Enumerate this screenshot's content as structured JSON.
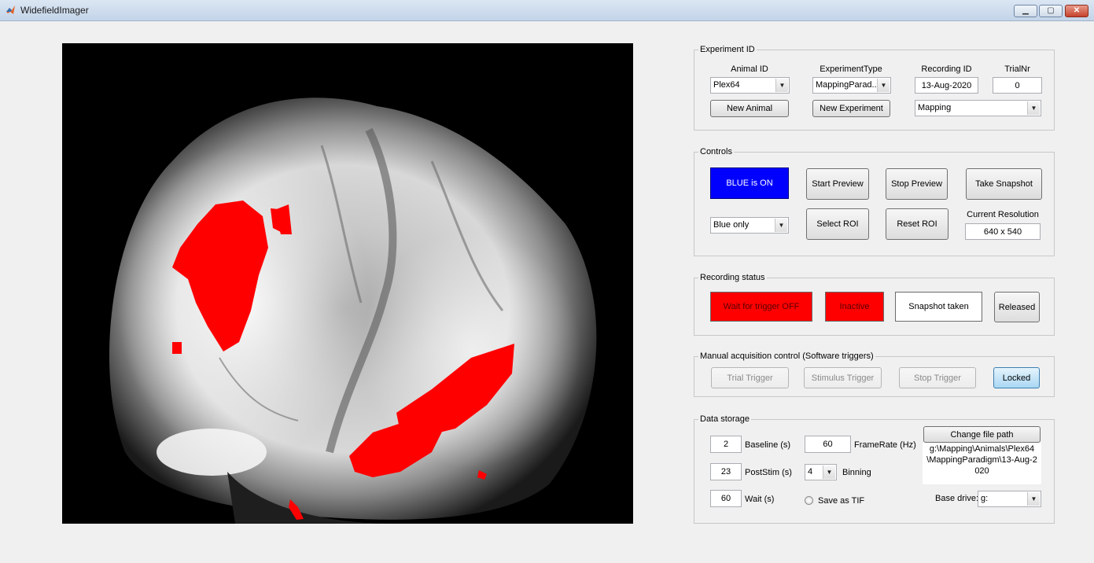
{
  "window": {
    "title": "WidefieldImager"
  },
  "experiment_id": {
    "title": "Experiment ID",
    "animal_id_label": "Animal ID",
    "experiment_type_label": "ExperimentType",
    "recording_id_label": "Recording ID",
    "trialnr_label": "TrialNr",
    "animal_id_value": "Plex64",
    "experiment_type_value": "MappingParad...",
    "recording_id_value": "13-Aug-2020",
    "trialnr_value": "0",
    "new_animal": "New Animal",
    "new_experiment": "New Experiment",
    "paradigm_value": "Mapping"
  },
  "controls": {
    "title": "Controls",
    "blue_status": "BLUE is ON",
    "start_preview": "Start Preview",
    "stop_preview": "Stop Preview",
    "take_snapshot": "Take Snapshot",
    "light_mode_value": "Blue only",
    "select_roi": "Select ROI",
    "reset_roi": "Reset ROI",
    "current_resolution_label": "Current Resolution",
    "current_resolution_value": "640 x 540"
  },
  "recording_status": {
    "title": "Recording status",
    "trigger": "Wait for trigger OFF",
    "state": "Inactive",
    "snapshot": "Snapshot taken",
    "released": "Released"
  },
  "manual_acquisition": {
    "title": "Manual acquisition control (Software triggers)",
    "trial_trigger": "Trial Trigger",
    "stimulus_trigger": "Stimulus Trigger",
    "stop_trigger": "Stop Trigger",
    "locked": "Locked"
  },
  "data_storage": {
    "title": "Data storage",
    "baseline_value": "2",
    "baseline_label": "Baseline (s)",
    "framerate_value": "60",
    "framerate_label": "FrameRate (Hz)",
    "poststim_value": "23",
    "poststim_label": "PostStim (s)",
    "binning_value": "4",
    "binning_label": "Binning",
    "wait_value": "60",
    "wait_label": "Wait (s)",
    "save_as_tif_label": "Save as TIF",
    "change_file_path": "Change file path",
    "file_path": "g:\\Mapping\\Animals\\Plex64\\MappingParadigm\\13-Aug-2020",
    "base_drive_label": "Base drive:",
    "base_drive_value": "g:"
  },
  "colors": {
    "overlay_red": "#ff0000",
    "blue_on": "#0000ff",
    "locked_blue": "#a9d7f3",
    "window_bg": "#f0f0f0"
  },
  "icons": [
    "matlab-icon",
    "minimize-icon",
    "maximize-icon",
    "close-icon",
    "chevron-down-icon"
  ]
}
